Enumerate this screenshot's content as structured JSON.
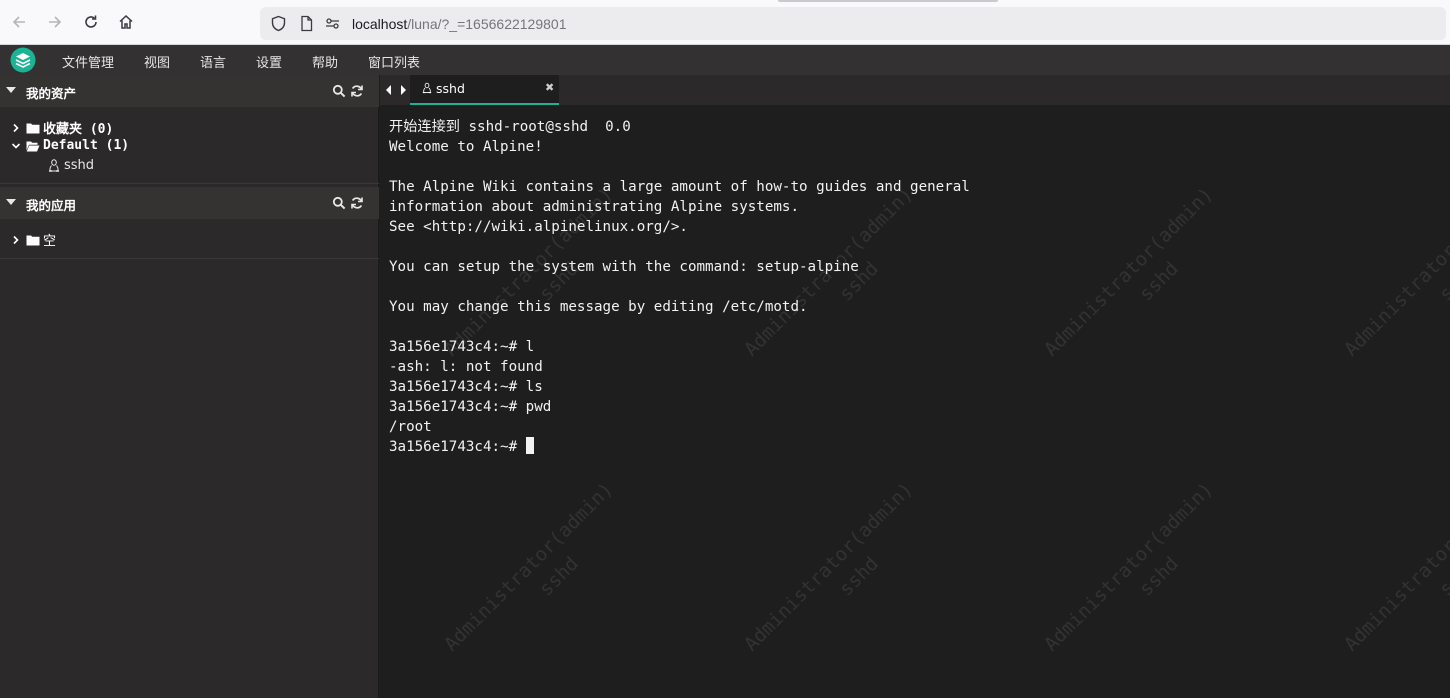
{
  "browser": {
    "url_host": "localhost",
    "url_path": "/luna/?_=1656622129801"
  },
  "menu": {
    "items": [
      "文件管理",
      "视图",
      "语言",
      "设置",
      "帮助",
      "窗口列表"
    ]
  },
  "sidebar": {
    "assets_title": "我的资产",
    "favorites_label": "收藏夹 (0)",
    "default_label": "Default (1)",
    "asset_item": "sshd",
    "apps_title": "我的应用",
    "apps_empty": "空"
  },
  "tab": {
    "label": "sshd",
    "close_glyph": "✖"
  },
  "terminal": {
    "lines": [
      "开始连接到 sshd-root@sshd  0.0",
      "Welcome to Alpine!",
      "",
      "The Alpine Wiki contains a large amount of how-to guides and general",
      "information about administrating Alpine systems.",
      "See <http://wiki.alpinelinux.org/>.",
      "",
      "You can setup the system with the command: setup-alpine",
      "",
      "You may change this message by editing /etc/motd.",
      "",
      "3a156e1743c4:~# l",
      "-ash: l: not found",
      "3a156e1743c4:~# ls",
      "3a156e1743c4:~# pwd",
      "/root"
    ],
    "prompt": "3a156e1743c4:~# "
  },
  "watermark": {
    "user": "Administrator(admin)",
    "asset": "sshd"
  },
  "colors": {
    "accent": "#1ab394",
    "terminal_bg": "#1e1e1e",
    "sidebar_bg": "#2b2929"
  }
}
